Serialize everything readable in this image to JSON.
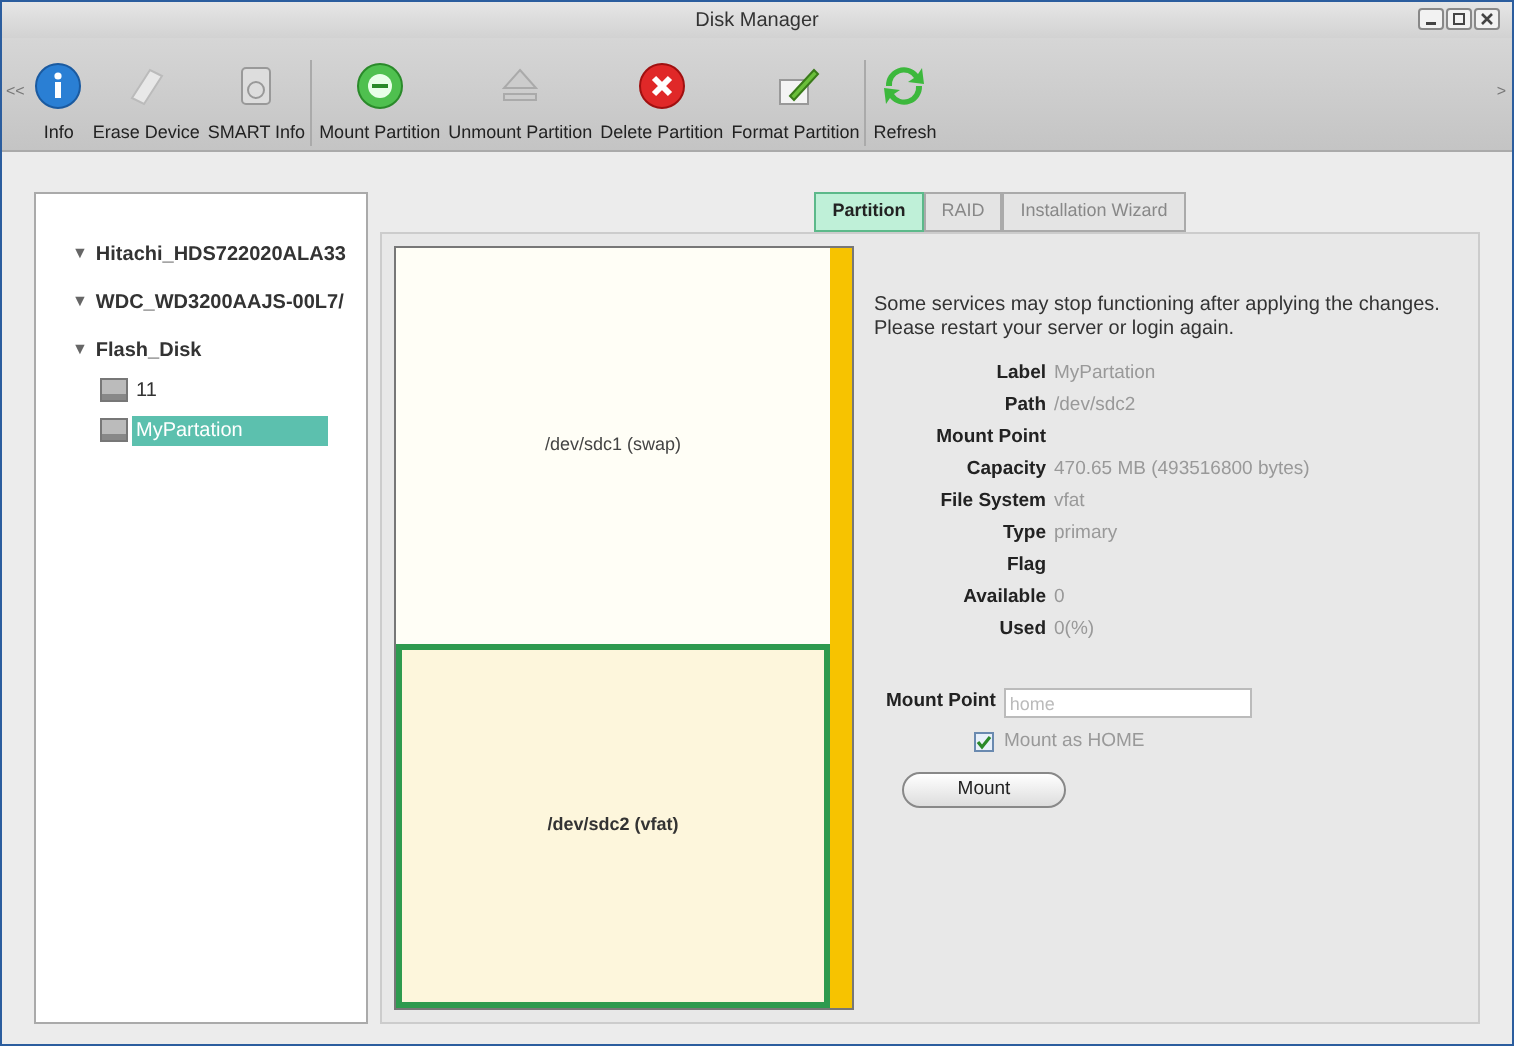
{
  "window": {
    "title": "Disk Manager"
  },
  "toolbar": {
    "scroll_left": "<<",
    "scroll_right": ">",
    "items": [
      {
        "label": "Info",
        "kind": "info",
        "group_end": false
      },
      {
        "label": "Erase Device",
        "kind": "eraser",
        "group_end": false
      },
      {
        "label": "SMART Info",
        "kind": "drive",
        "group_end": true
      },
      {
        "label": "Mount Partition",
        "kind": "plug",
        "group_end": false
      },
      {
        "label": "Unmount Partition",
        "kind": "eject",
        "group_end": false
      },
      {
        "label": "Delete Partition",
        "kind": "delete",
        "group_end": false
      },
      {
        "label": "Format Partition",
        "kind": "pencil",
        "group_end": true
      },
      {
        "label": "Refresh",
        "kind": "refresh",
        "group_end": false
      }
    ]
  },
  "tree": [
    {
      "label": "Hitachi_HDS722020ALA33",
      "kind": "disk",
      "toggle": "▼",
      "selected": false
    },
    {
      "label": "WDC_WD3200AAJS-00L7/",
      "kind": "disk",
      "toggle": "▼",
      "selected": false
    },
    {
      "label": "Flash_Disk",
      "kind": "disk",
      "toggle": "▼",
      "selected": false,
      "children": [
        {
          "label": "11",
          "kind": "partition",
          "selected": false
        },
        {
          "label": "MyPartation",
          "kind": "partition",
          "selected": true
        }
      ]
    }
  ],
  "tabs": [
    {
      "label": "Partition",
      "selected": true
    },
    {
      "label": "RAID",
      "selected": false
    },
    {
      "label": "Installation Wizard",
      "selected": false
    }
  ],
  "partitions": [
    {
      "label": "/dev/sdc1 (swap)",
      "selected": false
    },
    {
      "label": "/dev/sdc2 (vfat)",
      "selected": true
    }
  ],
  "notice": "Some services may stop functioning after applying the changes. Please restart your server or login again.",
  "details": [
    {
      "label": "Label",
      "value": "MyPartation"
    },
    {
      "label": "Path",
      "value": "/dev/sdc2"
    },
    {
      "label": "Mount Point"
    },
    {
      "label": "Capacity",
      "value": "470.65 MB (493516800 bytes)"
    },
    {
      "label": "File System",
      "value": "vfat"
    },
    {
      "label": "Type",
      "value": "primary"
    },
    {
      "label": "Flag"
    },
    {
      "label": "Available",
      "value": "0"
    },
    {
      "label": "Used",
      "value": "0(%)"
    }
  ],
  "mount_form": {
    "label": "Mount Point",
    "placeholder": "home",
    "checkbox": {
      "label": "Mount as HOME",
      "checked": true
    },
    "button": "Mount"
  }
}
